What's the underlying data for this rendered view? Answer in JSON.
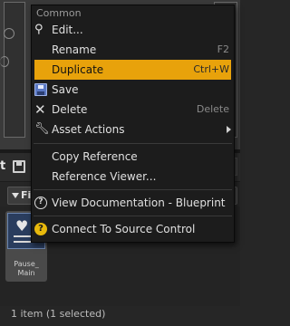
{
  "background": {
    "toolbar_partial_text": "t",
    "filter_label": "Fil",
    "asset": {
      "name_line1": "Pause_",
      "name_line2": "Main"
    },
    "status": "1 item (1 selected)"
  },
  "menu": {
    "section_header": "Common",
    "items": [
      {
        "label": "Edit...",
        "shortcut": "",
        "icon": "edit-icon"
      },
      {
        "label": "Rename",
        "shortcut": "F2",
        "icon": ""
      },
      {
        "label": "Duplicate",
        "shortcut": "Ctrl+W",
        "icon": "",
        "highlighted": true
      },
      {
        "label": "Save",
        "shortcut": "",
        "icon": "save-icon"
      },
      {
        "label": "Delete",
        "shortcut": "Delete",
        "icon": "delete-icon"
      },
      {
        "label": "Asset Actions",
        "shortcut": "",
        "icon": "wrench-icon",
        "submenu": true
      },
      {
        "label": "Copy Reference",
        "shortcut": "",
        "icon": ""
      },
      {
        "label": "Reference Viewer...",
        "shortcut": "",
        "icon": ""
      },
      {
        "label": "View Documentation - Blueprint",
        "shortcut": "",
        "icon": "help-icon"
      },
      {
        "label": "Connect To Source Control",
        "shortcut": "",
        "icon": "source-control-icon"
      }
    ]
  },
  "colors": {
    "highlight": "#e8a20b",
    "menu_bg": "#1c1c1c"
  }
}
